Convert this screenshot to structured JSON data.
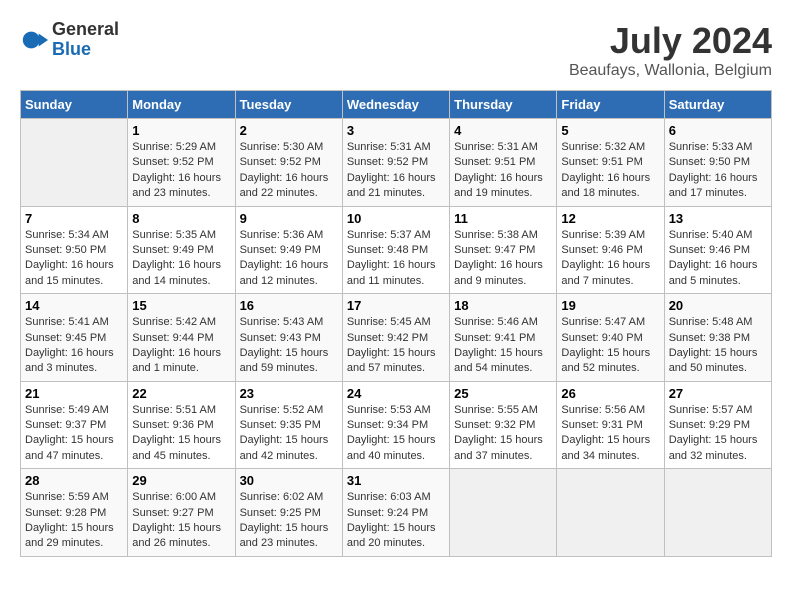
{
  "header": {
    "logo_general": "General",
    "logo_blue": "Blue",
    "main_title": "July 2024",
    "subtitle": "Beaufays, Wallonia, Belgium"
  },
  "columns": [
    "Sunday",
    "Monday",
    "Tuesday",
    "Wednesday",
    "Thursday",
    "Friday",
    "Saturday"
  ],
  "weeks": [
    {
      "cells": [
        {
          "empty": true
        },
        {
          "day": "1",
          "sunrise": "5:29 AM",
          "sunset": "9:52 PM",
          "daylight": "16 hours and 23 minutes."
        },
        {
          "day": "2",
          "sunrise": "5:30 AM",
          "sunset": "9:52 PM",
          "daylight": "16 hours and 22 minutes."
        },
        {
          "day": "3",
          "sunrise": "5:31 AM",
          "sunset": "9:52 PM",
          "daylight": "16 hours and 21 minutes."
        },
        {
          "day": "4",
          "sunrise": "5:31 AM",
          "sunset": "9:51 PM",
          "daylight": "16 hours and 19 minutes."
        },
        {
          "day": "5",
          "sunrise": "5:32 AM",
          "sunset": "9:51 PM",
          "daylight": "16 hours and 18 minutes."
        },
        {
          "day": "6",
          "sunrise": "5:33 AM",
          "sunset": "9:50 PM",
          "daylight": "16 hours and 17 minutes."
        }
      ]
    },
    {
      "cells": [
        {
          "day": "7",
          "sunrise": "5:34 AM",
          "sunset": "9:50 PM",
          "daylight": "16 hours and 15 minutes."
        },
        {
          "day": "8",
          "sunrise": "5:35 AM",
          "sunset": "9:49 PM",
          "daylight": "16 hours and 14 minutes."
        },
        {
          "day": "9",
          "sunrise": "5:36 AM",
          "sunset": "9:49 PM",
          "daylight": "16 hours and 12 minutes."
        },
        {
          "day": "10",
          "sunrise": "5:37 AM",
          "sunset": "9:48 PM",
          "daylight": "16 hours and 11 minutes."
        },
        {
          "day": "11",
          "sunrise": "5:38 AM",
          "sunset": "9:47 PM",
          "daylight": "16 hours and 9 minutes."
        },
        {
          "day": "12",
          "sunrise": "5:39 AM",
          "sunset": "9:46 PM",
          "daylight": "16 hours and 7 minutes."
        },
        {
          "day": "13",
          "sunrise": "5:40 AM",
          "sunset": "9:46 PM",
          "daylight": "16 hours and 5 minutes."
        }
      ]
    },
    {
      "cells": [
        {
          "day": "14",
          "sunrise": "5:41 AM",
          "sunset": "9:45 PM",
          "daylight": "16 hours and 3 minutes."
        },
        {
          "day": "15",
          "sunrise": "5:42 AM",
          "sunset": "9:44 PM",
          "daylight": "16 hours and 1 minute."
        },
        {
          "day": "16",
          "sunrise": "5:43 AM",
          "sunset": "9:43 PM",
          "daylight": "15 hours and 59 minutes."
        },
        {
          "day": "17",
          "sunrise": "5:45 AM",
          "sunset": "9:42 PM",
          "daylight": "15 hours and 57 minutes."
        },
        {
          "day": "18",
          "sunrise": "5:46 AM",
          "sunset": "9:41 PM",
          "daylight": "15 hours and 54 minutes."
        },
        {
          "day": "19",
          "sunrise": "5:47 AM",
          "sunset": "9:40 PM",
          "daylight": "15 hours and 52 minutes."
        },
        {
          "day": "20",
          "sunrise": "5:48 AM",
          "sunset": "9:38 PM",
          "daylight": "15 hours and 50 minutes."
        }
      ]
    },
    {
      "cells": [
        {
          "day": "21",
          "sunrise": "5:49 AM",
          "sunset": "9:37 PM",
          "daylight": "15 hours and 47 minutes."
        },
        {
          "day": "22",
          "sunrise": "5:51 AM",
          "sunset": "9:36 PM",
          "daylight": "15 hours and 45 minutes."
        },
        {
          "day": "23",
          "sunrise": "5:52 AM",
          "sunset": "9:35 PM",
          "daylight": "15 hours and 42 minutes."
        },
        {
          "day": "24",
          "sunrise": "5:53 AM",
          "sunset": "9:34 PM",
          "daylight": "15 hours and 40 minutes."
        },
        {
          "day": "25",
          "sunrise": "5:55 AM",
          "sunset": "9:32 PM",
          "daylight": "15 hours and 37 minutes."
        },
        {
          "day": "26",
          "sunrise": "5:56 AM",
          "sunset": "9:31 PM",
          "daylight": "15 hours and 34 minutes."
        },
        {
          "day": "27",
          "sunrise": "5:57 AM",
          "sunset": "9:29 PM",
          "daylight": "15 hours and 32 minutes."
        }
      ]
    },
    {
      "cells": [
        {
          "day": "28",
          "sunrise": "5:59 AM",
          "sunset": "9:28 PM",
          "daylight": "15 hours and 29 minutes."
        },
        {
          "day": "29",
          "sunrise": "6:00 AM",
          "sunset": "9:27 PM",
          "daylight": "15 hours and 26 minutes."
        },
        {
          "day": "30",
          "sunrise": "6:02 AM",
          "sunset": "9:25 PM",
          "daylight": "15 hours and 23 minutes."
        },
        {
          "day": "31",
          "sunrise": "6:03 AM",
          "sunset": "9:24 PM",
          "daylight": "15 hours and 20 minutes."
        },
        {
          "empty": true
        },
        {
          "empty": true
        },
        {
          "empty": true
        }
      ]
    }
  ],
  "labels": {
    "sunrise_prefix": "Sunrise: ",
    "sunset_prefix": "Sunset: ",
    "daylight_prefix": "Daylight: "
  }
}
